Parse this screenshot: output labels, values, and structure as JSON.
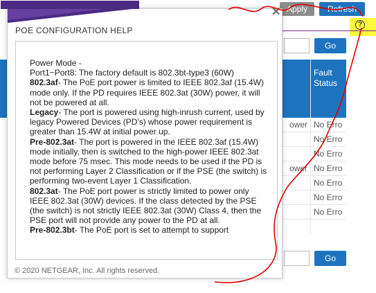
{
  "toolbar": {
    "apply_label": "Apply",
    "refresh_label": "Refresh",
    "help_icon": "?"
  },
  "background": {
    "go_label": "Go",
    "table_header": {
      "line1": "Fault",
      "line2": "Status"
    },
    "rows": [
      {
        "power": "ower",
        "fault": "No Erro"
      },
      {
        "power": "",
        "fault": "No Erro"
      },
      {
        "power": "",
        "fault": "No Erro"
      },
      {
        "power": "ower",
        "fault": "No Erro"
      },
      {
        "power": "",
        "fault": "No Erro"
      },
      {
        "power": "",
        "fault": "No Erro"
      },
      {
        "power": "",
        "fault": "No Erro"
      }
    ]
  },
  "modal": {
    "title": "POE CONFIGURATION HELP",
    "footer": "© 2020 NETGEAR, Inc. All rights reserved.",
    "content": {
      "heading": "Power Mode -",
      "port_default": "Port1~Port8: The factory default is 802.3bt-type3 (60W)",
      "items": [
        {
          "term": "802.3af",
          "text": "- The PoE port power is limited to IEEE 802.3af (15.4W) mode only. If the PD requires IEEE 802.3at (30W) power, it will not be powered at all."
        },
        {
          "term": "Legacy",
          "text": "- The port is powered using high-inrush current, used by legacy Powered Devices (PD's) whose power requirement is greater than 15.4W at initial power up."
        },
        {
          "term": "Pre-802.3at",
          "text": "- The port is powered in the IEEE 802.3af (15.4W) mode initially, then is switched to the high-power IEEE 802.3at mode before 75 msec. This mode needs to be used if the PD is not performing Layer 2 Classification or if the PSE (the switch) is performing two-event Layer 1 Classification."
        },
        {
          "term": "802.3at",
          "text": "- The PoE port power is strictly limited to power only IEEE 802.3at (30W) devices. If the class detected by the PSE (the switch) is not strictly IEEE 802.3at (30W) Class 4, then the PSE port will not provide any power to the PD at all."
        },
        {
          "term": "Pre-802.3bt",
          "text": "- The PoE port is set to attempt to support"
        }
      ]
    }
  },
  "colors": {
    "accent": "#1e73be",
    "brand_purple": "#4b2a84",
    "highlight": "#fffb3c",
    "annotation": "#e00000"
  }
}
